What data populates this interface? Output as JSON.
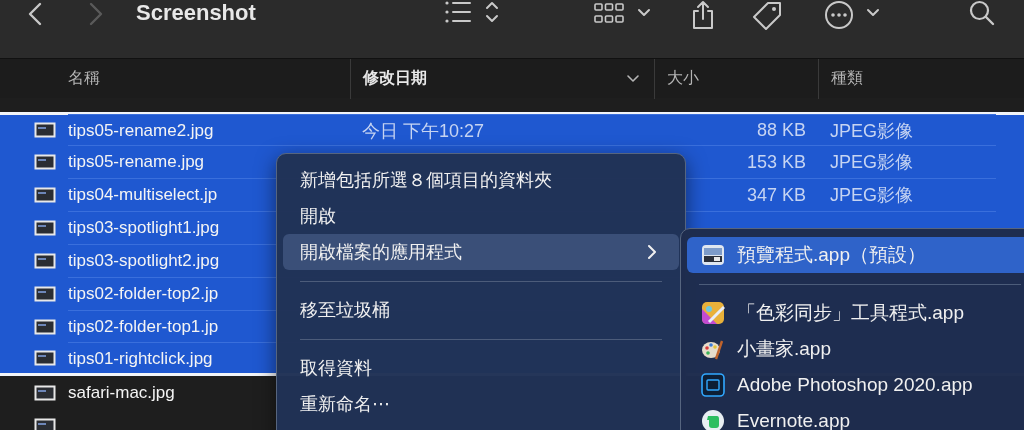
{
  "toolbar": {
    "title": "Screenshot",
    "back_disabled": false,
    "forward_disabled": true
  },
  "columns": [
    {
      "label": "名稱",
      "sorted": false
    },
    {
      "label": "修改日期",
      "sorted": true
    },
    {
      "label": "大小",
      "sorted": false
    },
    {
      "label": "種類",
      "sorted": false
    }
  ],
  "files": [
    {
      "name": "tips05-rename2.jpg",
      "date": "今日 下午10:27",
      "size": "88 KB",
      "kind": "JPEG影像",
      "selected": true
    },
    {
      "name": "tips05-rename.jpg",
      "size": "153 KB",
      "kind": "JPEG影像",
      "selected": true
    },
    {
      "name": "tips04-multiselect.jp",
      "size": "347 KB",
      "kind": "JPEG影像",
      "selected": true
    },
    {
      "name": "tips03-spotlight1.jpg",
      "selected": true
    },
    {
      "name": "tips03-spotlight2.jpg",
      "selected": true
    },
    {
      "name": "tips02-folder-top2.jp",
      "selected": true
    },
    {
      "name": "tips02-folder-top1.jp",
      "selected": true
    },
    {
      "name": "tips01-rightclick.jpg",
      "selected": true
    },
    {
      "name": "safari-mac.jpg",
      "selected": false
    },
    {
      "selected": false
    }
  ],
  "context_menu": {
    "items": [
      {
        "kind": "item",
        "label": "新增包括所選８個項目的資料夾",
        "selected": false,
        "has_submenu": false
      },
      {
        "kind": "item",
        "label": "開啟",
        "selected": false,
        "has_submenu": false
      },
      {
        "kind": "item",
        "label": "開啟檔案的應用程式",
        "selected": true,
        "has_submenu": true
      },
      {
        "kind": "separator"
      },
      {
        "kind": "item",
        "label": "移至垃圾桶",
        "selected": false,
        "has_submenu": false
      },
      {
        "kind": "separator"
      },
      {
        "kind": "item",
        "label": "取得資料",
        "selected": false,
        "has_submenu": false
      },
      {
        "kind": "item",
        "label": "重新命名⋯",
        "selected": false,
        "has_submenu": false
      }
    ]
  },
  "submenu": {
    "items": [
      {
        "kind": "item",
        "label": "預覽程式.app（預設）",
        "selected": true
      },
      {
        "kind": "separator"
      },
      {
        "kind": "item",
        "label": "「色彩同步」工具程式.app",
        "selected": false
      },
      {
        "kind": "item",
        "label": "小畫家.app",
        "selected": false
      },
      {
        "kind": "item",
        "label": "Adobe Photoshop 2020.app",
        "selected": false
      },
      {
        "kind": "item",
        "label": "Evernote.app",
        "selected": false
      }
    ]
  }
}
